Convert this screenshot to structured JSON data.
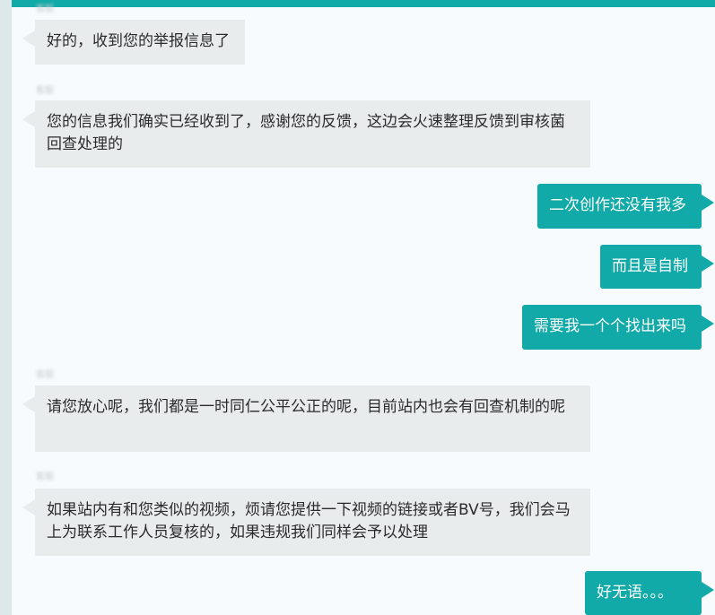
{
  "chat": {
    "top_sender": "客服",
    "messages": [
      {
        "side": "received",
        "sender": "客服",
        "text": "好的，收到您的举报信息了"
      },
      {
        "side": "received",
        "sender": "客服",
        "text": "您的信息我们确实已经收到了，感谢您的反馈，这边会火速整理反馈到审核菌回查处理的"
      },
      {
        "side": "sent",
        "text": "二次创作还没有我多"
      },
      {
        "side": "sent",
        "text": "而且是自制"
      },
      {
        "side": "sent",
        "text": "需要我一个个找出来吗"
      },
      {
        "side": "received",
        "sender": "客服",
        "text": "请您放心呢，我们都是一时同仁公平公正的呢，目前站内也会有回查机制的呢"
      },
      {
        "side": "received",
        "sender": "客服",
        "text": "如果站内有和您类似的视频，烦请您提供一下视频的链接或者BV号，我们会马上为联系工作人员复核的，如果违规我们同样会予以处理"
      },
      {
        "side": "sent",
        "text": "好无语。。。"
      }
    ]
  },
  "colors": {
    "header": "#11aaa9",
    "sent_bubble": "#11aaa9",
    "received_bubble": "#e8eced",
    "background": "#f7fbfd"
  }
}
